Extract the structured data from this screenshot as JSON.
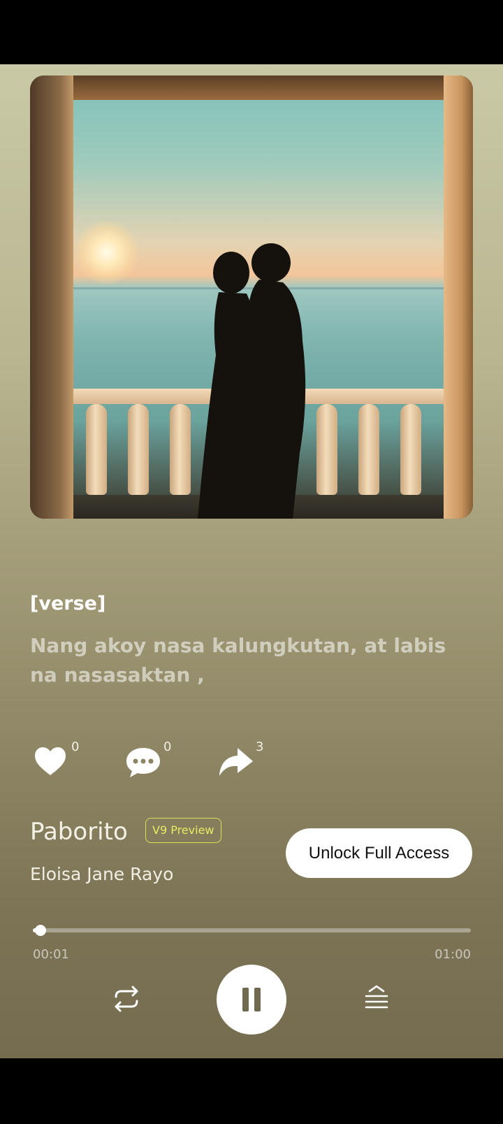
{
  "lyrics": {
    "section_tag": "[verse]",
    "current_line": "Nang akoy nasa kalungkutan, at labis na nasasaktan ,"
  },
  "actions": {
    "like": {
      "icon": "heart-icon",
      "count": "0"
    },
    "comment": {
      "icon": "comment-icon",
      "count": "0"
    },
    "share": {
      "icon": "share-icon",
      "count": "3"
    }
  },
  "song": {
    "title": "Paborito",
    "badge": "V9 Preview",
    "artist": "Eloisa Jane Rayo",
    "unlock_label": "Unlock Full Access"
  },
  "player": {
    "current_time": "00:01",
    "duration": "01:00",
    "progress_fraction": 0.017,
    "state": "playing",
    "controls": [
      "repeat-icon",
      "pause-icon",
      "queue-icon"
    ]
  },
  "colors": {
    "badge": "#e6ec63",
    "background_top": "#c9c9a5",
    "background_bottom": "#756c50"
  }
}
